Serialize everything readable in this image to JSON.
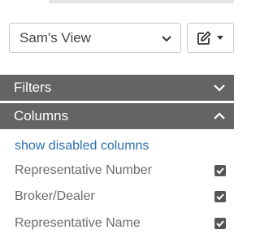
{
  "view_select": {
    "selected": "Sam's View"
  },
  "panels": {
    "filters": {
      "label": "Filters"
    },
    "columns": {
      "label": "Columns"
    }
  },
  "columns": {
    "show_disabled_link": "show disabled columns",
    "items": [
      {
        "label": "Representative Number",
        "checked": true
      },
      {
        "label": "Broker/Dealer",
        "checked": true
      },
      {
        "label": "Representative Name",
        "checked": true
      }
    ]
  },
  "icons": {
    "edit": "pencil-square-icon",
    "filters_toggle": "chevron-down-icon",
    "columns_toggle": "chevron-up-icon"
  },
  "colors": {
    "header_bg": "#646464",
    "link": "#2a6fb0",
    "checkbox": "#555555"
  }
}
